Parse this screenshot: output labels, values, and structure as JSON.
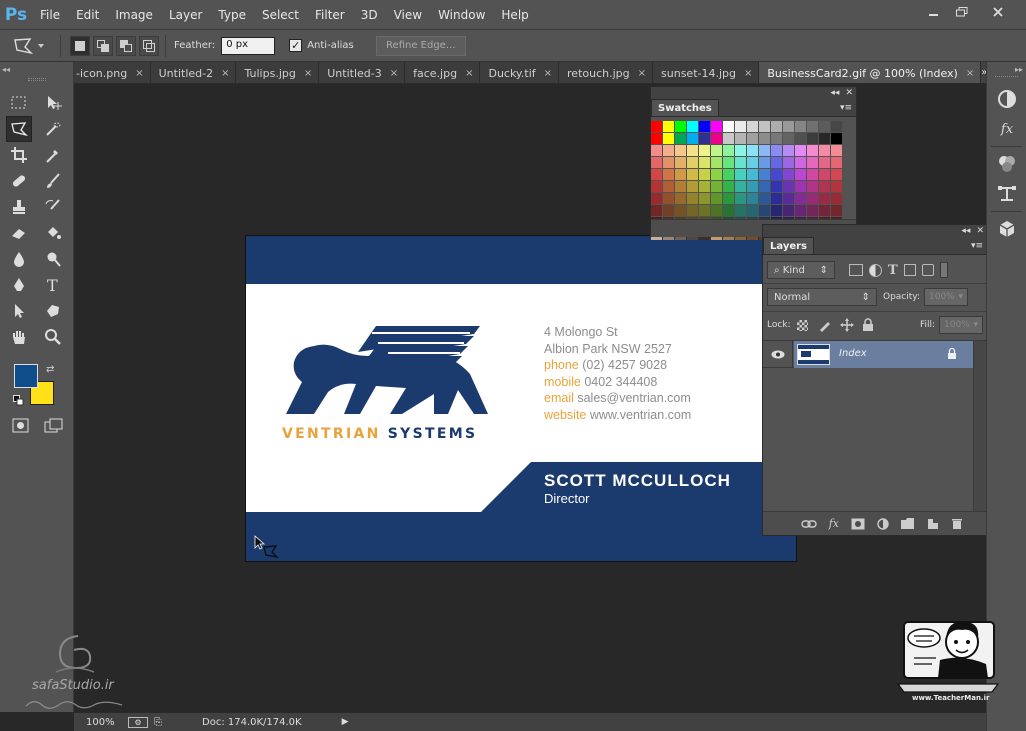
{
  "menubar": {
    "logo": "Ps",
    "items": [
      "File",
      "Edit",
      "Image",
      "Layer",
      "Type",
      "Select",
      "Filter",
      "3D",
      "View",
      "Window",
      "Help"
    ]
  },
  "options": {
    "feather_label": "Feather:",
    "feather_value": "0 px",
    "antialias_label": "Anti-alias",
    "refine_label": "Refine Edge..."
  },
  "tabs": [
    {
      "label": "-icon.png"
    },
    {
      "label": "Untitled-2"
    },
    {
      "label": "Tulips.jpg"
    },
    {
      "label": "Untitled-3"
    },
    {
      "label": "face.jpg"
    },
    {
      "label": "Ducky.tif"
    },
    {
      "label": "retouch.jpg"
    },
    {
      "label": "sunset-14.jpg"
    },
    {
      "label": "BusinessCard2.gif @ 100% (Index)"
    }
  ],
  "card": {
    "company_a": "VENTRIAN",
    "company_b": "SYSTEMS",
    "address1": "4 Molongo St",
    "address2": "Albion Park NSW 2527",
    "phone_label": "phone",
    "phone_value": "(02) 4257 9028",
    "mobile_label": "mobile",
    "mobile_value": "0402 344408",
    "email_label": "email",
    "email_value": "sales@ventrian.com",
    "website_label": "website",
    "website_value": "www.ventrian.com",
    "name": "SCOTT MCCULLOCH",
    "role": "Director",
    "navy": "#1b3a6e",
    "orange": "#e8a33a"
  },
  "swatches_panel": {
    "title": "Swatches"
  },
  "layers_panel": {
    "title": "Layers",
    "kind_label": "Kind",
    "blend_mode": "Normal",
    "opacity_label": "Opacity:",
    "opacity_value": "100%",
    "lock_label": "Lock:",
    "fill_label": "Fill:",
    "fill_value": "100%",
    "layer_name": "Index"
  },
  "status": {
    "zoom": "100%",
    "doc": "Doc: 174.0K/174.0K"
  },
  "watermark": {
    "site": "safaStudio.ir",
    "teacher_site": "www.TeacherMan.ir"
  },
  "colors": {
    "foreground": "#0f4d8c",
    "background": "#ffe11a"
  }
}
